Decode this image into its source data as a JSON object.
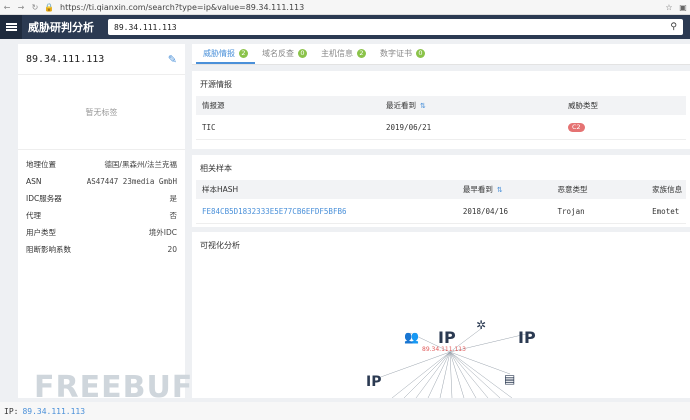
{
  "browser": {
    "url": "https://ti.qianxin.com/search?type=ip&value=89.34.111.113"
  },
  "app": {
    "brand": "威胁研判分析",
    "search_value": "89.34.111.113"
  },
  "left": {
    "ip": "89.34.111.113",
    "tags_empty": "暂无标签",
    "rows": [
      {
        "k": "地理位置",
        "v": "德国/黑森州/法兰克福"
      },
      {
        "k": "ASN",
        "v": "AS47447 23media GmbH"
      },
      {
        "k": "IDC服务器",
        "v": "是"
      },
      {
        "k": "代理",
        "v": "否"
      },
      {
        "k": "用户类型",
        "v": "境外IDC"
      },
      {
        "k": "阻断影响系数",
        "v": "20"
      }
    ]
  },
  "tabs": [
    {
      "label": "威胁情报",
      "count": "2"
    },
    {
      "label": "域名反查",
      "count": "0"
    },
    {
      "label": "主机信息",
      "count": "2"
    },
    {
      "label": "数字证书",
      "count": "0"
    }
  ],
  "osint": {
    "title": "开源情报",
    "headers": [
      "情报源",
      "最近看到",
      "威胁类型"
    ],
    "row": {
      "source": "TIC",
      "date": "2019/06/21",
      "tag": "C2"
    }
  },
  "samples": {
    "title": "相关样本",
    "headers": [
      "样本HASH",
      "最早看到",
      "恶意类型",
      "家族信息"
    ],
    "row": {
      "hash": "FE84CB5D1832333E5E77CB6EFDF5BFB6",
      "date": "2018/04/16",
      "type": "Trojan",
      "family": "Emotet"
    }
  },
  "graph": {
    "title": "可视化分析",
    "center_label": "89.34.111.113",
    "ip_label": "IP"
  },
  "statusbar": {
    "label": "IP:",
    "value": "89.34.111.113"
  },
  "watermark": "FREEBUF"
}
